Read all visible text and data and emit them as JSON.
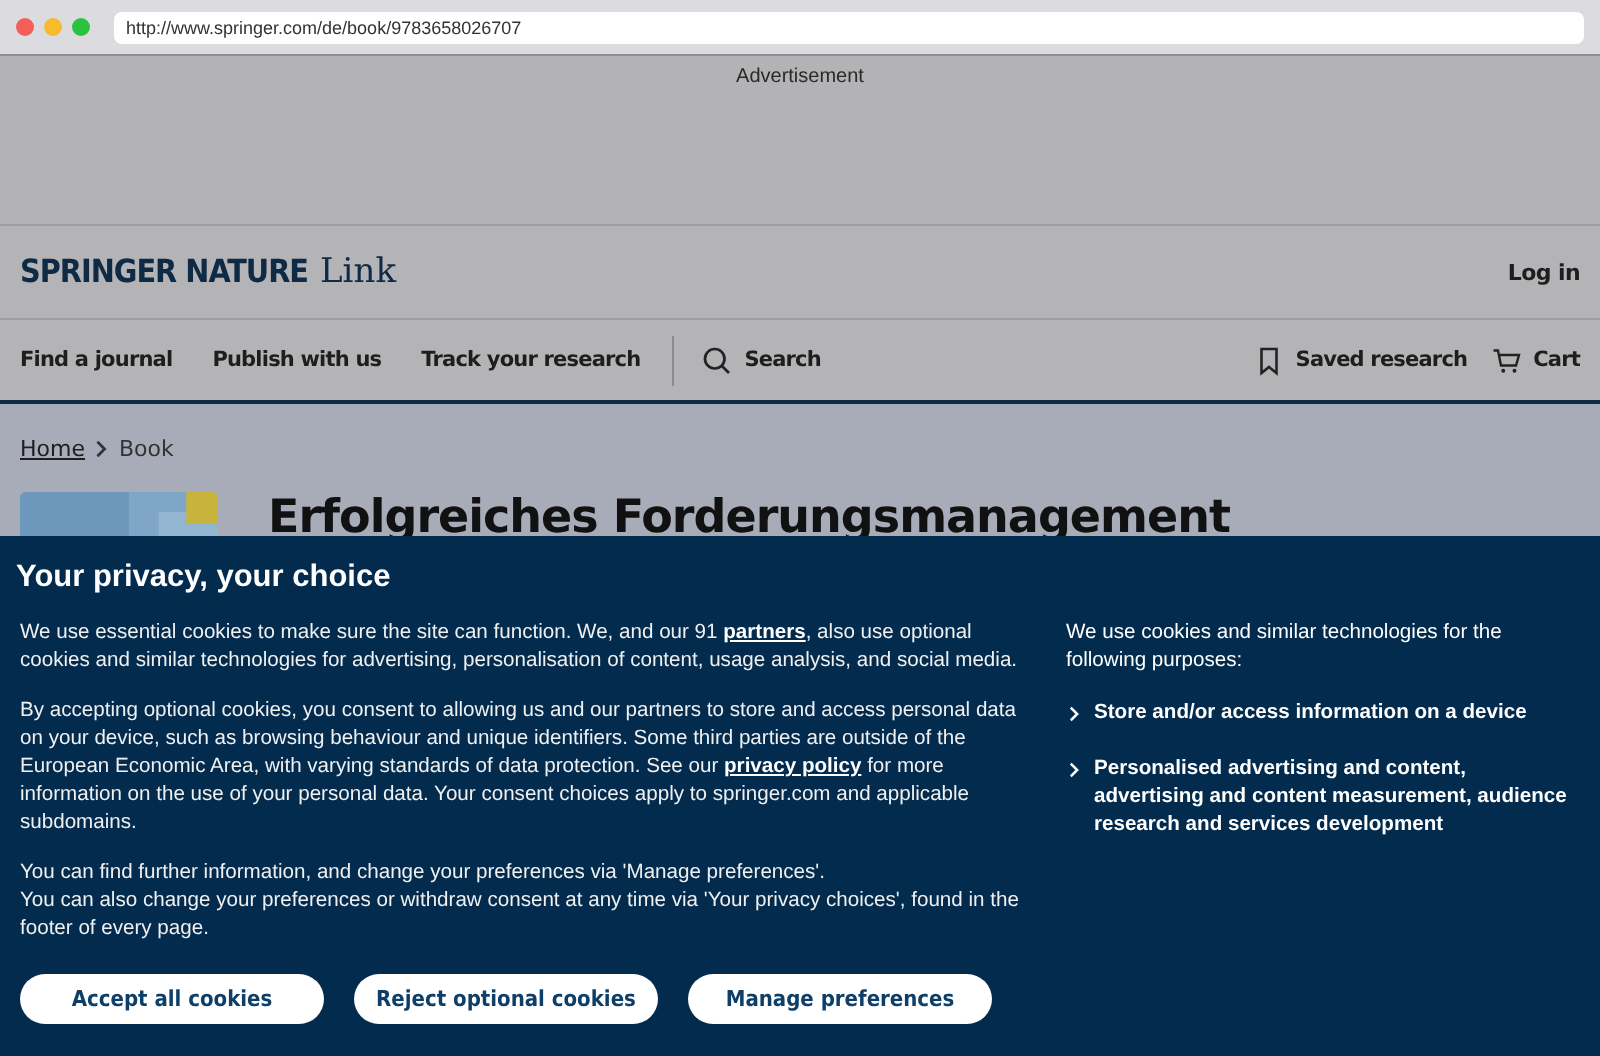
{
  "browser": {
    "url": "http://www.springer.com/de/book/9783658026707"
  },
  "advert": {
    "label": "Advertisement"
  },
  "header": {
    "brand": "SPRINGER NATURE",
    "product": "Link",
    "login": "Log in"
  },
  "nav": {
    "items": [
      "Find a journal",
      "Publish with us",
      "Track your research"
    ],
    "search": "Search",
    "saved": "Saved research",
    "cart": "Cart"
  },
  "breadcrumb": [
    {
      "label": "Home",
      "kind": "link"
    },
    {
      "label": "Book",
      "kind": "current"
    }
  ],
  "book": {
    "title": "Erfolgreiches Forderungsmanagement"
  },
  "consent": {
    "title": "Your privacy, your choice",
    "paragraphs": [
      [
        {
          "kind": "text",
          "text": "We use essential cookies to make sure the site can function. We, and our 91 "
        },
        {
          "kind": "link",
          "text": "partners"
        },
        {
          "kind": "text",
          "text": ", also use optional cookies and similar technologies for advertising, personalisation of content, usage analysis, and social media."
        }
      ],
      [
        {
          "kind": "text",
          "text": "By accepting optional cookies, you consent to allowing us and our partners to store and access personal data on your device, such as browsing behaviour and unique identifiers. Some third parties are outside of the European Economic Area, with varying standards of data protection. See our "
        },
        {
          "kind": "link",
          "text": "privacy policy"
        },
        {
          "kind": "text",
          "text": " for more information on the use of your personal data. Your consent choices apply to springer.com and applicable subdomains."
        }
      ],
      [
        {
          "kind": "text",
          "text": "You can find further information, and change your preferences via 'Manage preferences'."
        },
        {
          "kind": "break"
        },
        {
          "kind": "text",
          "text": "You can also change your preferences or withdraw consent at any time via 'Your privacy choices', found in the footer of every page."
        }
      ]
    ],
    "buttons": [
      "Accept all cookies",
      "Reject optional cookies",
      "Manage preferences"
    ],
    "purposes_intro": "We use cookies and similar technologies for the following purposes:",
    "purposes": [
      {
        "label": "Store and/or access information on a device",
        "expanded": false
      },
      {
        "label": "Personalised advertising and content, advertising and content measurement, audience research and services development",
        "expanded": false
      }
    ]
  }
}
